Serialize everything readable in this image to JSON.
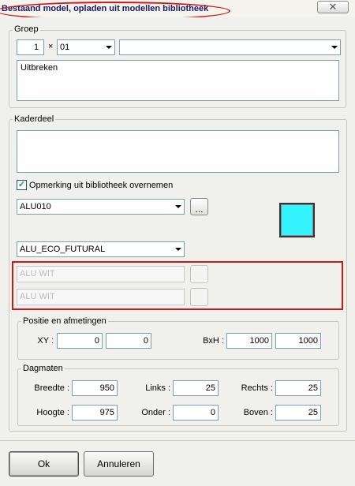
{
  "window": {
    "title": "Bestaand model, opladen uit modellen bibliotheek",
    "close_symbol": "✕"
  },
  "groep": {
    "legend": "Groep",
    "number_value": "1",
    "separator": "×",
    "code_value": "01",
    "name_value": "",
    "description": "Uitbreken"
  },
  "kaderdeel": {
    "legend": "Kaderdeel",
    "text_value": "",
    "checkbox_label": "Opmerking uit bibliotheek overnemen",
    "checkbox_checked": true,
    "profile_value": "ALU010",
    "browse_label": "...",
    "color_swatch": "#33f3ff",
    "system_value": "ALU_ECO_FUTURAL",
    "color_inside": "ALU WIT",
    "color_outside": "ALU WIT"
  },
  "positie": {
    "legend": "Positie en afmetingen",
    "xy_label": "XY :",
    "x_value": "0",
    "y_value": "0",
    "bxh_label": "BxH :",
    "b_value": "1000",
    "h_value": "1000"
  },
  "dagmaten": {
    "legend": "Dagmaten",
    "breedte_label": "Breedte :",
    "breedte_value": "950",
    "links_label": "Links :",
    "links_value": "25",
    "rechts_label": "Rechts :",
    "rechts_value": "25",
    "hoogte_label": "Hoogte :",
    "hoogte_value": "975",
    "onder_label": "Onder :",
    "onder_value": "0",
    "boven_label": "Boven :",
    "boven_value": "25"
  },
  "buttons": {
    "ok": "Ok",
    "cancel": "Annuleren"
  }
}
